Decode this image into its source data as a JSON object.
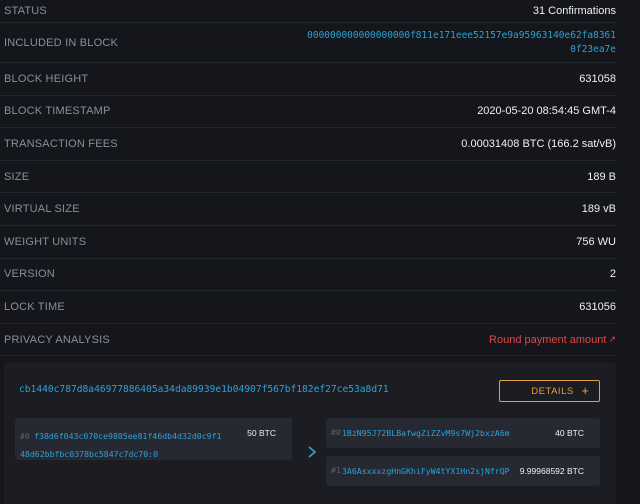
{
  "details": [
    {
      "label": "STATUS",
      "value": "31 Confirmations"
    },
    {
      "label": "INCLUDED IN BLOCK",
      "value": "000000000000000000f811e171eee52157e9a95963140e62fa83610f23ea7e"
    },
    {
      "label": "BLOCK HEIGHT",
      "value": "631058"
    },
    {
      "label": "BLOCK TIMESTAMP",
      "value": "2020-05-20 08:54:45 GMT-4"
    },
    {
      "label": "TRANSACTION FEES",
      "value": "0.00031408 BTC (166.2 sat/vB)"
    },
    {
      "label": "SIZE",
      "value": "189 B"
    },
    {
      "label": "VIRTUAL SIZE",
      "value": "189 vB"
    },
    {
      "label": "WEIGHT UNITS",
      "value": "756 WU"
    },
    {
      "label": "VERSION",
      "value": "2"
    },
    {
      "label": "LOCK TIME",
      "value": "631056"
    },
    {
      "label": "PRIVACY ANALYSIS",
      "value": "Round payment amount"
    }
  ],
  "transaction": {
    "txid": "cb1440c787d8a46977886405a34da89939e1b04907f567bf182ef27ce53a8d71",
    "details_button": "DETAILS",
    "input": {
      "index": "#0",
      "address": "f38d6f043c070ce9805ee81f46db4d32d0c9f148d62bbfbc0378bc5847c7dc70:0",
      "amount": "50 BTC"
    },
    "outputs": [
      {
        "index": "#0",
        "address": "1BzN95J72BLBafwgZiZZvM9s7Wj2bxzA6m",
        "amount": "40 BTC"
      },
      {
        "index": "#1",
        "address": "3A6AsxxxzgHnGKhiFyW4tYX1Hn2sjNfrQP",
        "amount": "9.99968592 BTC"
      }
    ]
  },
  "colors": {
    "background": "#14161b",
    "link": "#2aa3d8",
    "accent": "#e3a13a",
    "warning": "#e0474a"
  },
  "icons": {
    "external_link": "external-link-icon",
    "plus": "plus-icon",
    "arrow": "chevron-right-icon"
  }
}
